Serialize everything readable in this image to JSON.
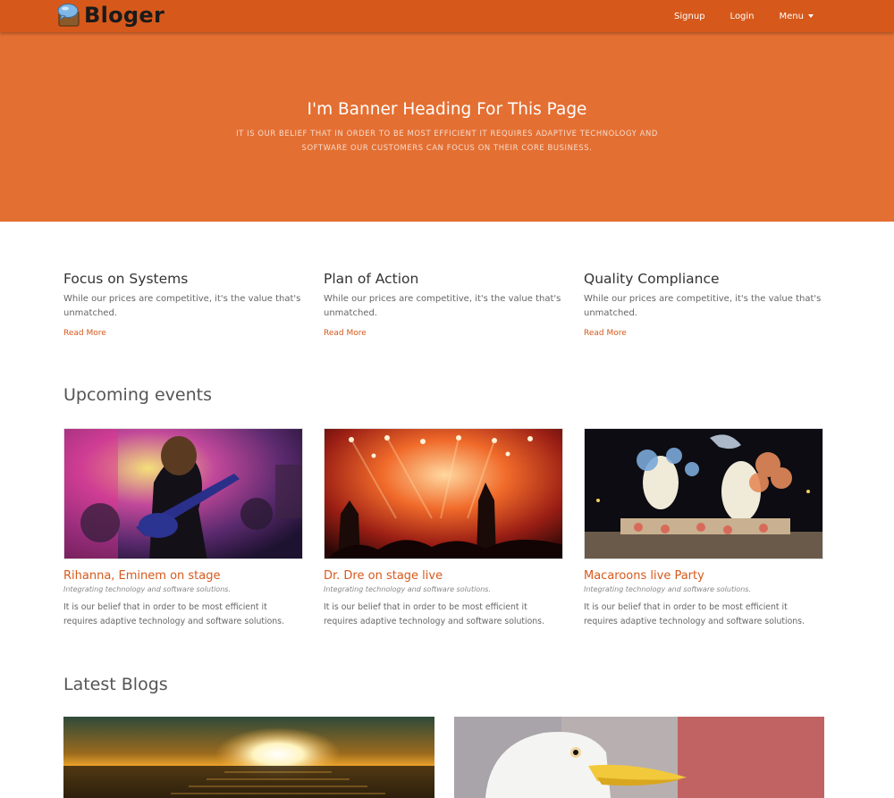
{
  "nav": {
    "brand": "Bloger",
    "links": [
      {
        "label": "Signup"
      },
      {
        "label": "Login"
      },
      {
        "label": "Menu"
      }
    ]
  },
  "banner": {
    "heading": "I'm Banner Heading For This Page",
    "subtext": "IT IS OUR BELIEF THAT IN ORDER TO BE MOST EFFICIENT IT REQUIRES ADAPTIVE TECHNOLOGY AND SOFTWARE OUR CUSTOMERS CAN FOCUS ON THEIR CORE BUSINESS."
  },
  "features": [
    {
      "title": "Focus on Systems",
      "text": "While our prices are competitive, it's the value that's unmatched.",
      "link": "Read More"
    },
    {
      "title": "Plan of Action",
      "text": "While our prices are competitive, it's the value that's unmatched.",
      "link": "Read More"
    },
    {
      "title": "Quality Compliance",
      "text": "While our prices are competitive, it's the value that's unmatched.",
      "link": "Read More"
    }
  ],
  "events": {
    "heading": "Upcoming events",
    "items": [
      {
        "title": "Rihanna, Eminem on stage",
        "tagline": "Integrating technology and software solutions.",
        "text": "It is our belief that in order to be most efficient it requires adaptive technology and software solutions.",
        "image": "guitarist-on-stage-photo"
      },
      {
        "title": "Dr. Dre on stage live",
        "tagline": "Integrating technology and software solutions.",
        "text": "It is our belief that in order to be most efficient it requires adaptive technology and software solutions.",
        "image": "concert-lights-photo"
      },
      {
        "title": "Macaroons live Party",
        "tagline": "Integrating technology and software solutions.",
        "text": "It is our belief that in order to be most efficient it requires adaptive technology and software solutions.",
        "image": "festival-sculpture-photo"
      }
    ]
  },
  "blogs": {
    "heading": "Latest Blogs",
    "images": [
      "sunset-sea-photo",
      "seagull-photo"
    ]
  },
  "colors": {
    "navbar": "#d6591b",
    "banner": "#e46f32",
    "accent": "#d6591b"
  }
}
